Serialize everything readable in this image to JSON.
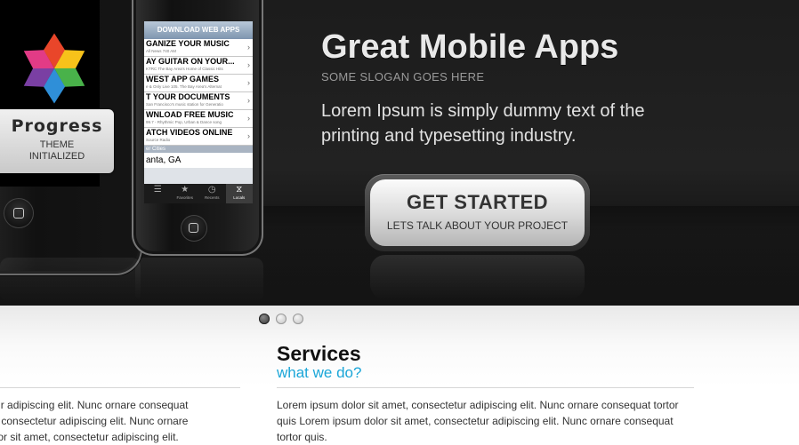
{
  "hero": {
    "title": "Great Mobile Apps",
    "slogan": "SOME SLOGAN GOES HERE",
    "description": "Lorem Ipsum is simply dummy text of the printing and typesetting industry.",
    "cta": {
      "title": "GET STARTED",
      "subtitle": "LETS TALK ABOUT YOUR PROJECT"
    }
  },
  "phone_left": {
    "card_title": "Progress",
    "card_line1": "THEME",
    "card_line2": "INITIALIZED",
    "logo_colors": [
      "#e9462a",
      "#f7c21a",
      "#49b24a",
      "#2f8fd8",
      "#7a3fa3",
      "#e23b86"
    ]
  },
  "phone_right": {
    "header": "DOWNLOAD WEB APPS",
    "rows": [
      {
        "title": "GANIZE YOUR MUSIC",
        "sub": "All News 740 AM"
      },
      {
        "title": "AY GUITAR ON YOUR...",
        "sub": "KTRC The Bay Area's Home of Classic Hits"
      },
      {
        "title": "WEST APP GAMES",
        "sub": "e & Only Live 105. The Bay Area's Alternat"
      },
      {
        "title": "T YOUR DOCUMENTS",
        "sub": "San Francisco's music station for Generatio"
      },
      {
        "title": "WNLOAD FREE MUSIC",
        "sub": "99.7 - Rhythmic Pop, Urban & Dance song"
      },
      {
        "title": "ATCH VIDEOS ONLINE",
        "sub": "Source Radio"
      }
    ],
    "section_label": "er Cities",
    "city": "anta, GA",
    "tabs": [
      "",
      "Favorites",
      "Recents",
      "Locals"
    ]
  },
  "slider": {
    "dots": 3,
    "active": 0
  },
  "services": {
    "title": "Services",
    "subtitle": "what we do?",
    "body": "Lorem ipsum dolor sit amet, consectetur adipiscing elit. Nunc ornare consequat tortor quis Lorem ipsum dolor sit amet, consectetur adipiscing elit. Nunc ornare consequat tortor quis."
  },
  "left_column": {
    "lines": [
      "ectetur adipiscing elit. Nunc ornare consequat",
      "amet, consectetur adipiscing elit. Nunc ornare",
      "m dolor sit amet, consectetur adipiscing elit."
    ]
  }
}
